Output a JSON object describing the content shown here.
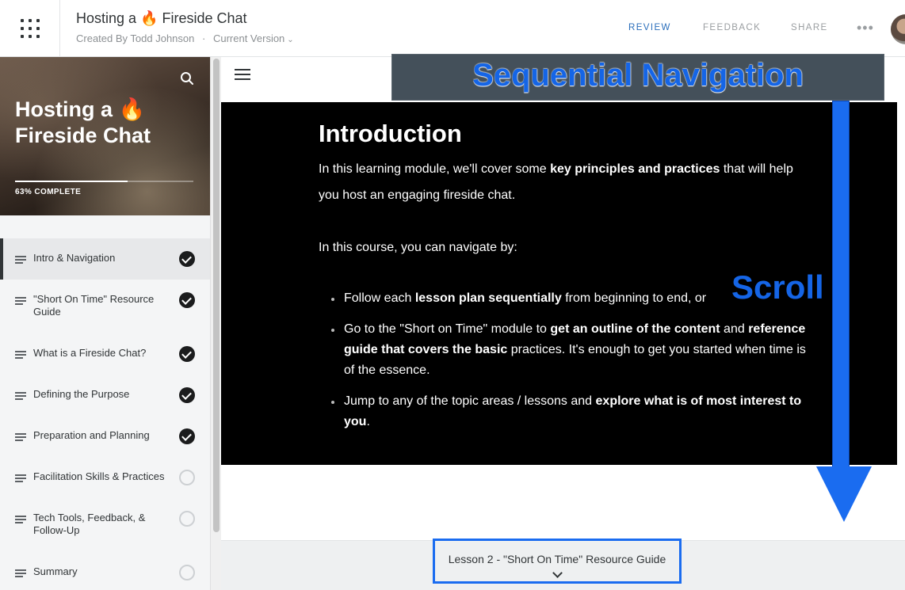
{
  "header": {
    "title_prefix": "Hosting a",
    "title_emoji": "🔥",
    "title_suffix": "Fireside Chat",
    "created_by": "Created By Todd Johnson",
    "separator": "·",
    "version": "Current Version",
    "nav": {
      "review": "REVIEW",
      "feedback": "FEEDBACK",
      "share": "SHARE",
      "more": "•••"
    }
  },
  "sidebar": {
    "course_title": "Hosting a 🔥 Fireside Chat",
    "progress_percent": 63,
    "progress_label": "63% COMPLETE",
    "lessons": [
      {
        "label": "Intro & Navigation",
        "status": "complete",
        "active": true
      },
      {
        "label": "\"Short On Time\" Resource Guide",
        "status": "complete"
      },
      {
        "label": "What is a Fireside Chat?",
        "status": "complete"
      },
      {
        "label": "Defining the Purpose",
        "status": "complete"
      },
      {
        "label": "Preparation and Planning",
        "status": "complete"
      },
      {
        "label": "Facilitation Skills & Practices",
        "status": "incomplete"
      },
      {
        "label": "Tech Tools, Feedback, & Follow-Up",
        "status": "incomplete"
      },
      {
        "label": "Summary",
        "status": "incomplete"
      }
    ]
  },
  "annotations": {
    "sequential": "Sequential Navigation",
    "scroll": "Scroll"
  },
  "content": {
    "heading": "Introduction",
    "p1_a": "In this learning module, we'll cover some ",
    "p1_b": "key principles and practices",
    "p1_c": " that will help you host an engaging fireside chat.",
    "p2": "In this course, you can navigate by:",
    "b1_a": "Follow each ",
    "b1_b": "lesson plan sequentially",
    "b1_c": " from beginning to end, or",
    "b2_a": "Go to the \"Short on Time\" module to ",
    "b2_b": "get an outline of the content",
    "b2_c": " and ",
    "b2_d": "reference guide that covers the basic",
    "b2_e": " practices. It's enough to get you started when time is of the essence.",
    "b3_a": "Jump to any of the topic areas / lessons and ",
    "b3_b": "explore what is of most interest to you",
    "b3_c": "."
  },
  "footer": {
    "next_label": "Lesson 2 - \"Short On Time\" Resource Guide"
  }
}
